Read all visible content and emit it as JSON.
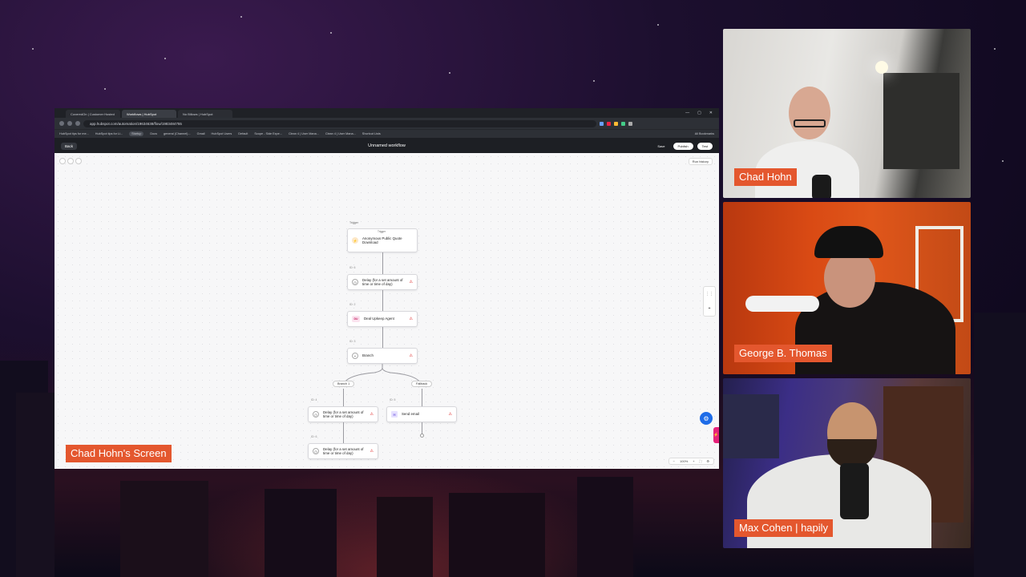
{
  "browser": {
    "tabs": [
      {
        "label": "CoveredOn | Customer Hosted"
      },
      {
        "label": "Workflows | HubSpot"
      },
      {
        "label": "No Billows | HubSpot"
      }
    ],
    "url": "app.hubspot.com/automation/19634638/flow/1983484755",
    "bookmarks": [
      "HubSpot tips for me...",
      "HubSpot tips for Li...",
      "Startup",
      "Docs",
      "general (Channel)...",
      "Gmail",
      "HubSpot Users",
      "Default",
      "Scope - Side Expe...",
      "Clean 4 | User Mana...",
      "Clean 4 | User Mana...",
      "Shortcut Lists",
      "All Bookmarks"
    ]
  },
  "app": {
    "back_label": "Back",
    "workflow_title": "Unnamed workflow",
    "save_label": "Save",
    "publish_label": "Publish",
    "test_label": "Test",
    "run_history_label": "Run history"
  },
  "flow": {
    "trigger_caption": "Trigger",
    "trigger_label": "Trigger",
    "trigger_name": "Anonymous Public Quote Download",
    "nodes": [
      {
        "id": "ID: 6",
        "label": "Delay (for a set amount of time or time of day)"
      },
      {
        "id": "ID: 2",
        "label": "Deal Upkeep Agent",
        "badge": "DU"
      },
      {
        "id": "ID: 3",
        "label": "Branch"
      },
      {
        "id": "ID: 4",
        "label": "Delay (for a set amount of time or time of day)"
      },
      {
        "id": "ID: 5",
        "label": "Send email"
      },
      {
        "id": "ID: 6",
        "label": "Delay (for a set amount of time or time of day)"
      }
    ],
    "branch_labels": [
      "Branch 1",
      "Fallback"
    ],
    "zoom": "100%"
  },
  "overlays": {
    "screen_label": "Chad Hohn's Screen",
    "cam_names": [
      "Chad Hohn",
      "George B. Thomas",
      "Max Cohen | hapily"
    ]
  },
  "colors": {
    "name_tag": "#e4572e",
    "hubspot_blue": "#1e6ce8",
    "warning": "#dd2222"
  }
}
